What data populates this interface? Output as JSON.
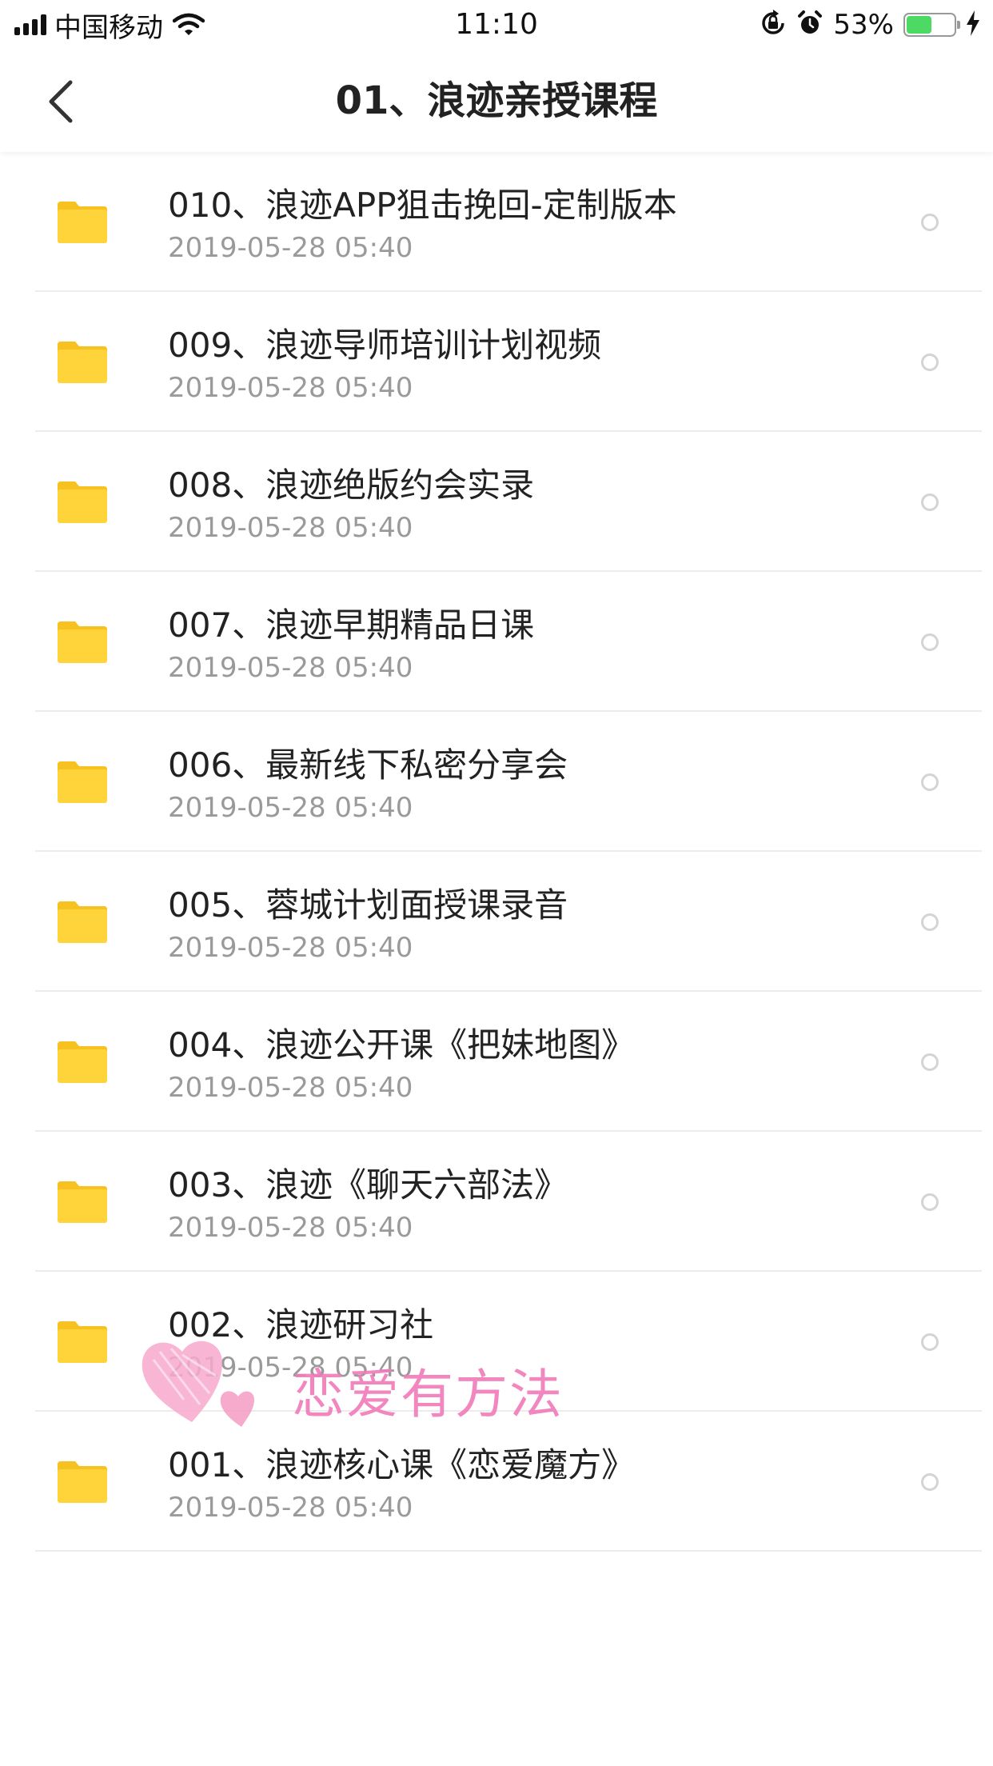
{
  "status_bar": {
    "carrier": "中国移动",
    "time": "11:10",
    "battery_percent_label": "53%",
    "battery_level": 0.53,
    "icons": [
      "signal-icon",
      "wifi-icon",
      "orientation-lock-icon",
      "alarm-icon",
      "battery-icon",
      "charging-icon"
    ]
  },
  "nav": {
    "title": "01、浪迹亲授课程",
    "back_icon": "chevron-left-icon"
  },
  "files": [
    {
      "name": "010、浪迹APP狙击挽回-定制版本",
      "date": "2019-05-28 05:40"
    },
    {
      "name": "009、浪迹导师培训计划视频",
      "date": "2019-05-28 05:40"
    },
    {
      "name": "008、浪迹绝版约会实录",
      "date": "2019-05-28 05:40"
    },
    {
      "name": "007、浪迹早期精品日课",
      "date": "2019-05-28 05:40"
    },
    {
      "name": "006、最新线下私密分享会",
      "date": "2019-05-28 05:40"
    },
    {
      "name": "005、蓉城计划面授课录音",
      "date": "2019-05-28 05:40"
    },
    {
      "name": "004、浪迹公开课《把妹地图》",
      "date": "2019-05-28 05:40"
    },
    {
      "name": "003、浪迹《聊天六部法》",
      "date": "2019-05-28 05:40"
    },
    {
      "name": "002、浪迹研习社",
      "date": "2019-05-28 05:40"
    },
    {
      "name": "001、浪迹核心课《恋爱魔方》",
      "date": "2019-05-28 05:40"
    }
  ],
  "watermark": {
    "text": "恋爱有方法"
  },
  "colors": {
    "folder": "#ffd43b",
    "folder_tab": "#f7c21f",
    "date_text": "#9a9a9a",
    "battery_fill": "#4cd964",
    "watermark": "#f07bb8"
  }
}
